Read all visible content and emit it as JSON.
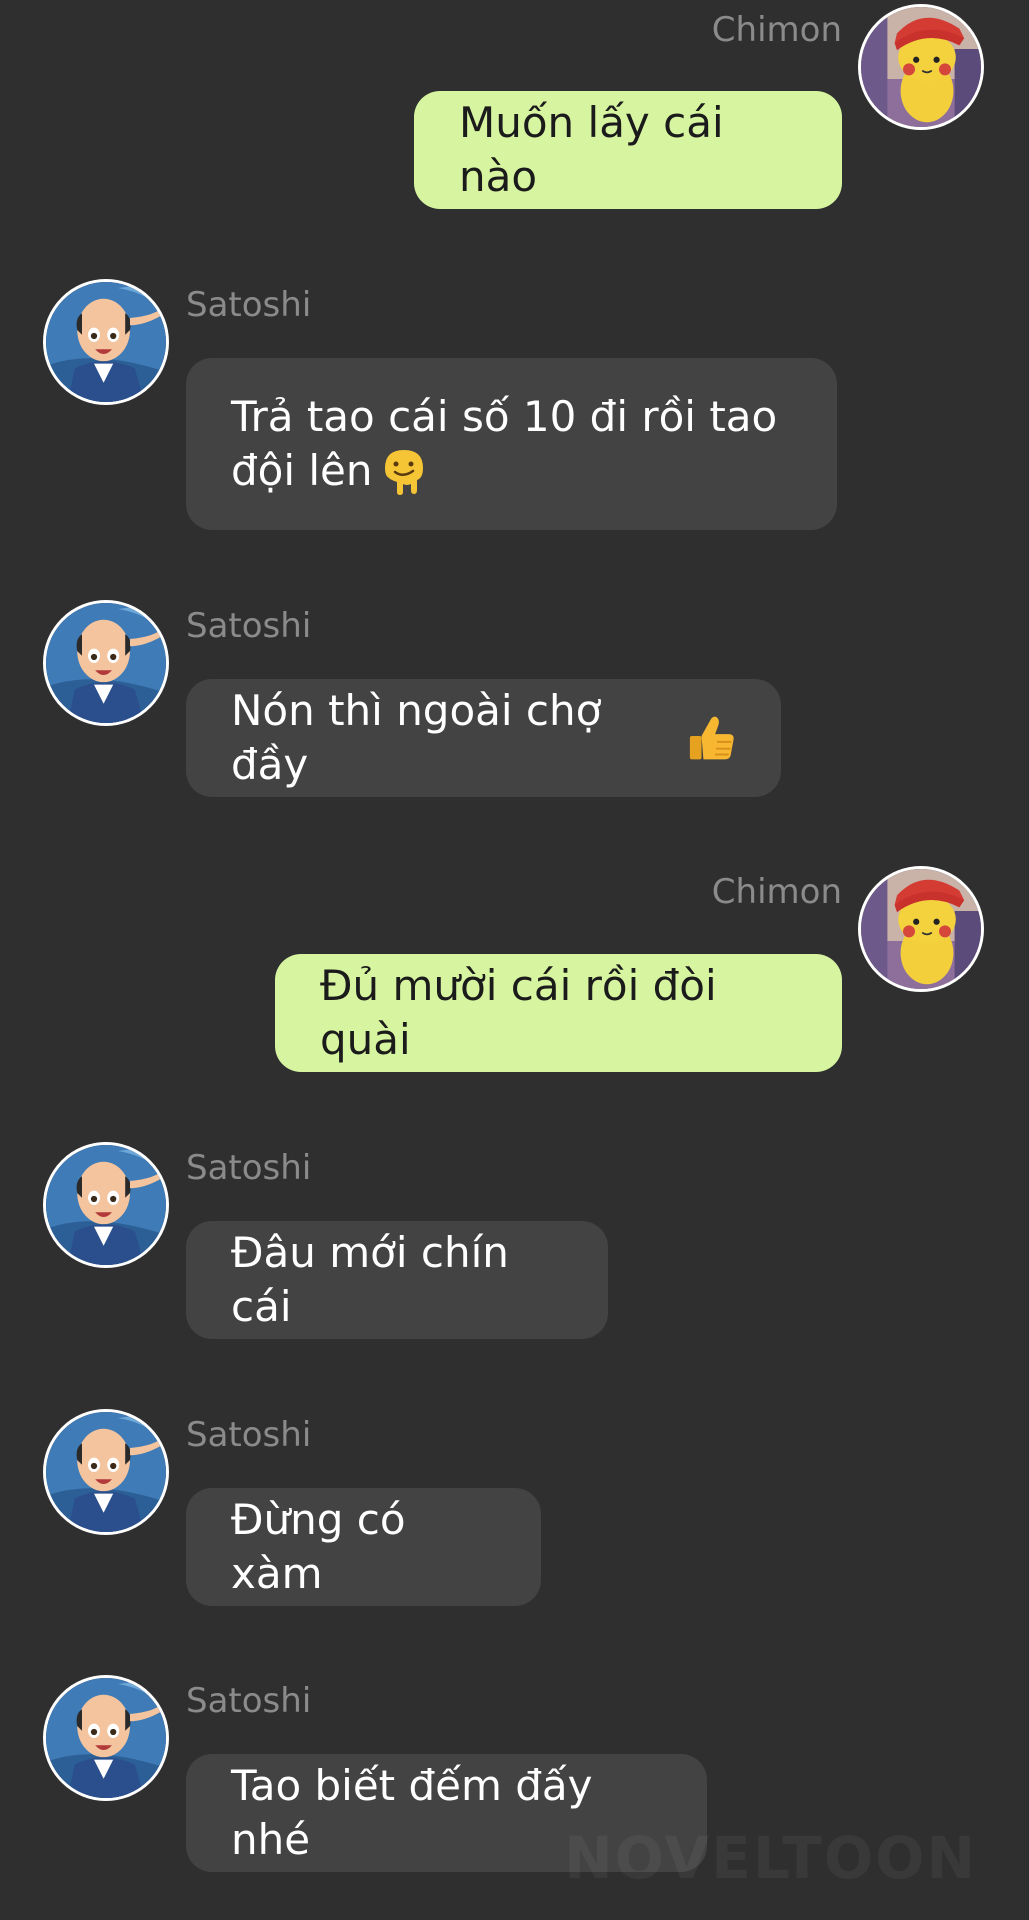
{
  "participants": {
    "me": "Chimon",
    "other": "Satoshi"
  },
  "avatar_icons": {
    "me": "pikachu-with-cap-avatar",
    "other": "ash-ketchum-avatar"
  },
  "messages": [
    {
      "sender": "Chimon",
      "text": "Muốn lấy cái nào"
    },
    {
      "sender": "Satoshi",
      "line1": "Trả tao cái số 10 đi rồi tao",
      "line2": "đội lên",
      "emoji": "melting-face-emoji"
    },
    {
      "sender": "Satoshi",
      "text": "Nón thì ngoài chợ đầy",
      "emoji": "thumbs-up-emoji"
    },
    {
      "sender": "Chimon",
      "text": "Đủ mười cái rồi đòi quài"
    },
    {
      "sender": "Satoshi",
      "text": "Đâu mới chín cái"
    },
    {
      "sender": "Satoshi",
      "text": "Đừng có xàm"
    },
    {
      "sender": "Satoshi",
      "text": "Tao biết đếm đấy nhé"
    }
  ],
  "colors": {
    "background": "#2f2f2f",
    "incoming_bubble": "#434343",
    "outgoing_bubble": "#d7f5a0",
    "name_text": "#8b8b8b"
  },
  "watermark": "NOVELTOON"
}
